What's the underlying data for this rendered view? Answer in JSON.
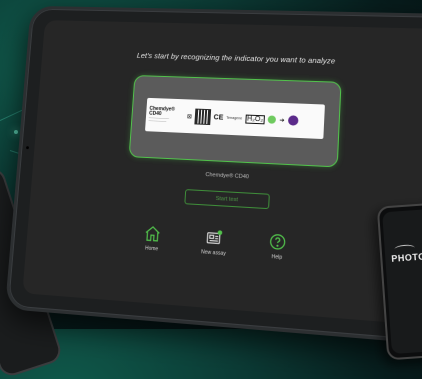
{
  "screen": {
    "headline": "Let's start by recognizing the indicator you want to analyze",
    "indicator": {
      "brand": "Chemdye® CD40",
      "symbols": [
        "⊠",
        "CE"
      ],
      "chemical": "H₂O₂",
      "logo": "Terragene"
    },
    "caption": "Chemdye® CD40",
    "start_button_label": "Start test",
    "nav": [
      {
        "label": "Home",
        "icon": "home-icon"
      },
      {
        "label": "New assay",
        "icon": "new-assay-icon"
      },
      {
        "label": "Help",
        "icon": "help-icon"
      }
    ]
  },
  "phone": {
    "brand": "PHOTO"
  },
  "colors": {
    "accent": "#52c24c",
    "screen_bg": "#262626",
    "card_bg": "#5b5b5b",
    "indicator_start": "#6fca5f",
    "indicator_end": "#5b2a8a"
  }
}
